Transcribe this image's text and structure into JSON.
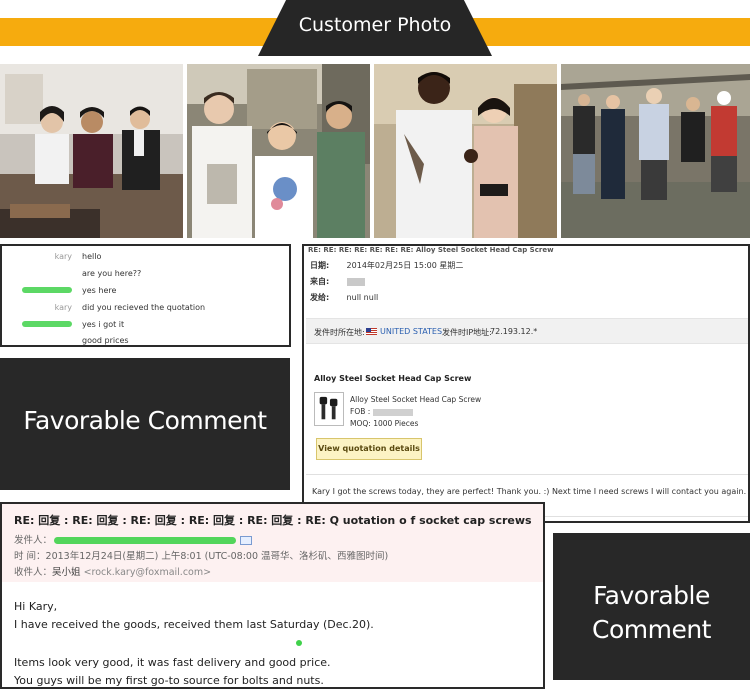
{
  "header": {
    "title": "Customer Photo"
  },
  "colors": {
    "banner": "#f6ab0e",
    "dark_panel": "#282828",
    "blur_green": "#3fd14a"
  },
  "photos": [
    {
      "name": "photo-office-meeting"
    },
    {
      "name": "photo-factory-visit-group"
    },
    {
      "name": "photo-customer-thumbs-up"
    },
    {
      "name": "photo-factory-tour"
    }
  ],
  "chat": {
    "rows": [
      {
        "sender": "kary",
        "message": "hello"
      },
      {
        "sender": "",
        "message": "are you here??"
      },
      {
        "sender": "",
        "message": "yes here"
      },
      {
        "sender": "kary",
        "message": "did you recieved the quotation"
      },
      {
        "sender": "",
        "message": "yes i got it"
      },
      {
        "sender": "",
        "message": "good prices"
      }
    ]
  },
  "favorable": {
    "label": "Favorable Comment",
    "label_line1": "Favorable",
    "label_line2": "Comment"
  },
  "mail_right": {
    "subject": "RE: RE: RE: RE: RE: RE: RE: Alloy Steel Socket Head Cap Screw",
    "date_key": "日期:",
    "date_value": "2014年02月25日  15:00  星期二",
    "from_key": "来自:",
    "sent_key": "发给:",
    "sent_value": "null null",
    "location_label": "发件时所在地:",
    "location_value": "UNITED STATES",
    "ip_label": "发件时IP地址:",
    "ip_value": "72.193.12.*",
    "product_title": "Alloy Steel Socket Head Cap Screw",
    "product_name": "Alloy Steel Socket Head Cap Screw",
    "fob_label": "FOB :",
    "moq": "MOQ: 1000 Pieces",
    "view_button": "View quotation details",
    "body": "Kary I got the screws today, they are perfect! Thank you. :) Next time I need screws I will contact you again. Thank you."
  },
  "mail_bottom": {
    "subject": "RE: 回复 : RE: 回复 : RE: 回复 : RE: 回复 : RE: 回复 : RE: Q uotation o f socket cap screws",
    "from_label": "发件人：",
    "time_label": "时   间：",
    "time_value": "2013年12月24日(星期二) 上午8:01 (UTC-08:00 温哥华、洛杉矶、西雅图时间)",
    "to_label": "收件人：",
    "to_name": "吴小姐",
    "to_email": "<rock.kary@foxmail.com>",
    "lines": [
      "Hi Kary,",
      "I have received the goods, received them last Saturday (Dec.20).",
      "Items look very good, it was fast delivery and good price.",
      "You guys will be my first go-to source for bolts and nuts."
    ]
  }
}
